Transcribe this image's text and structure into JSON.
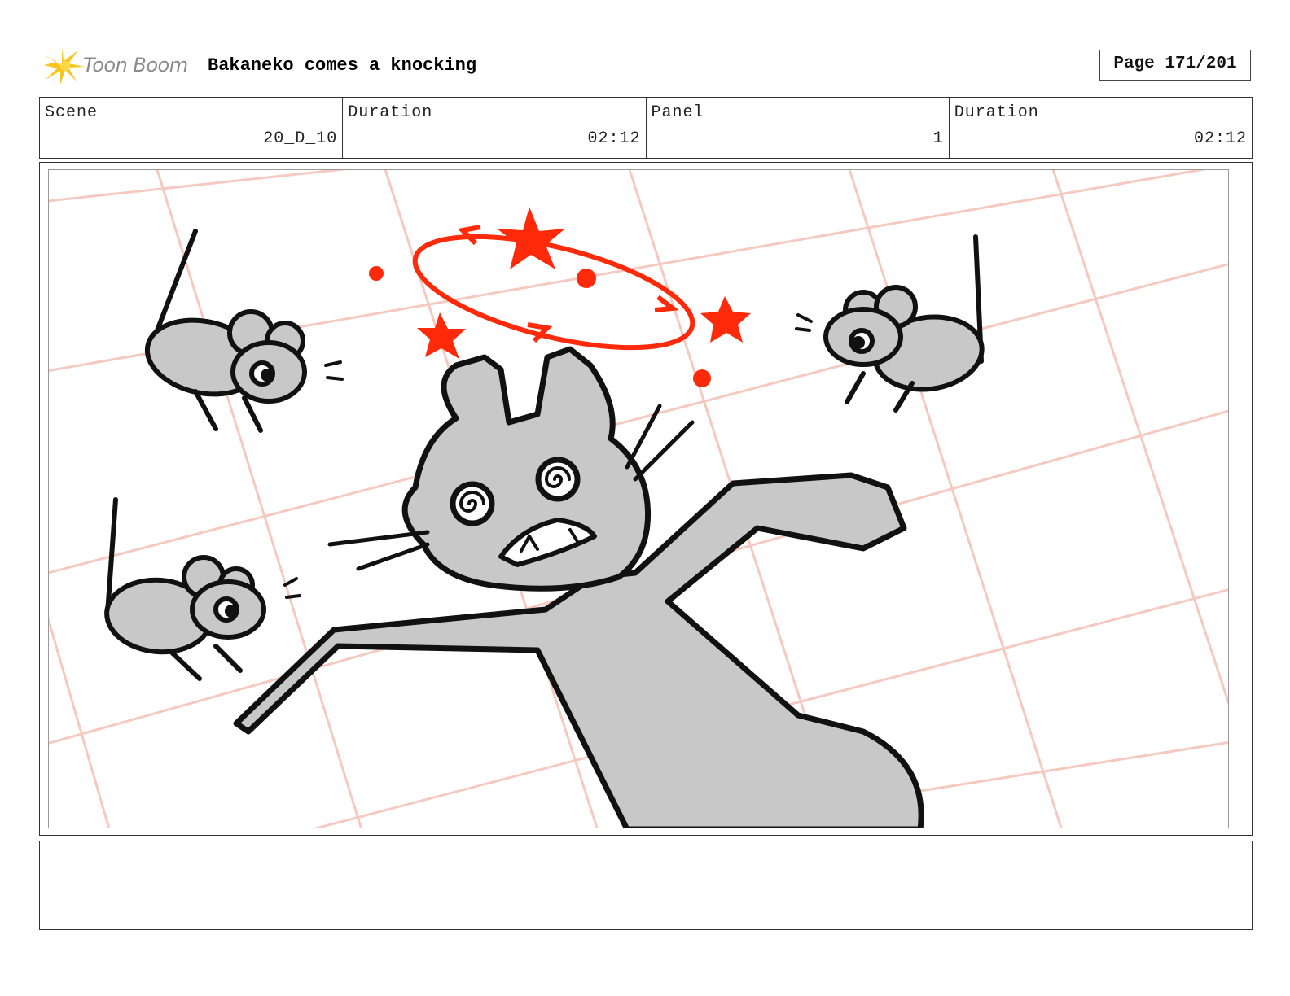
{
  "header": {
    "logo_text": "Toon Boom",
    "title": "Bakaneko comes a knocking",
    "page": "Page 171/201"
  },
  "info": {
    "scene_label": "Scene",
    "scene_value": "20_D_10",
    "duration_label": "Duration",
    "duration_value": "02:12",
    "panel_label": "Panel",
    "panel_value": "1",
    "panel_duration_label": "Duration",
    "panel_duration_value": "02:12"
  },
  "colors": {
    "grid": "#f6c9c0",
    "dizzy_red": "#ff2a0a",
    "fill_gray": "#c8c8c8",
    "ink": "#111111"
  },
  "notes": ""
}
